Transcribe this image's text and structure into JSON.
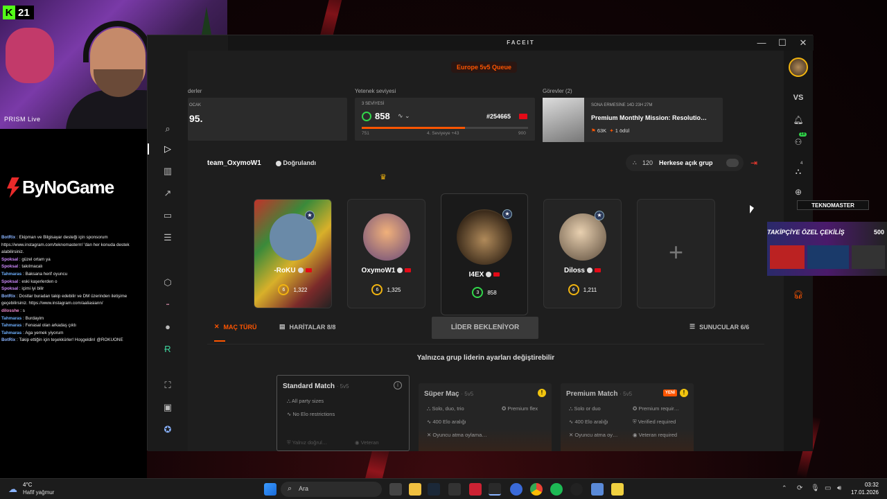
{
  "stream": {
    "kick_badge": "K",
    "viewer_count": "21",
    "prism_label": "PRISM Live",
    "sponsor_logo": "ByNoGame",
    "chat": [
      {
        "user": "BotRix",
        "text": "Ekipman ve Bilgisayar desteği için sponsorum https://www.instagram.com/teknomasterrr/ 'dan her konuda destek alabilirsiniz."
      },
      {
        "user": "Spoksal",
        "text": "güzel ortam ya"
      },
      {
        "user": "Spoksal",
        "text": "takılmacalı"
      },
      {
        "user": "Tahmaras",
        "text": "Baksana herif oyuncu"
      },
      {
        "user": "Spoksal",
        "text": "eski kaşerlerden o"
      },
      {
        "user": "Spoksal",
        "text": "içimi iyi bilir"
      },
      {
        "user": "BotRix",
        "text": "Dostlar buradan takip edebilir ve DM üzerinden iletişime geçebilirsiniz. https://www.instagram.com/aaliasiann/"
      },
      {
        "user": "dilosshe",
        "text": "s"
      },
      {
        "user": "Tahmaras",
        "text": "Burdayim"
      },
      {
        "user": "Tahmaras",
        "text": "Fenasal olan arkadaş çıktı"
      },
      {
        "user": "Tahmaras",
        "text": "Aga yemek yiyorum"
      },
      {
        "user": "BotRix",
        "text": "Takip ettiğin için teşekkürler! Hoşgeldin! @ROKUONE"
      }
    ],
    "overlay_brand": "TEKNOMASTER",
    "overlay_promo": "TAKİPÇİYE ÖZEL ÇEKİLİŞ",
    "overlay_promo_num": "500"
  },
  "window": {
    "title": "FACEIT",
    "minimize": "—",
    "maximize": "☐",
    "close": "✕"
  },
  "queue": "Europe 5v5 Queue",
  "header": {
    "col1_label": "derler",
    "col1_sub": "OCAK",
    "col1_value": "95.",
    "skill_label": "Yetenek seviyesi",
    "skill_level_text": "3 SEVİYESİ",
    "elo": "858",
    "rank": "#254665",
    "range_min": "751",
    "range_mid": "4. Seviyeye +43",
    "range_max": "900",
    "progress": 0.62,
    "missions_label": "Görevler (2)",
    "mission_deadline": "SONA ERMESİNE 14D 23H 27M",
    "mission_title": "Premium Monthly Mission: Resolutio…",
    "mission_points": "63K",
    "mission_reward": "1 ödül"
  },
  "team": {
    "name": "team_OxymoW1",
    "verified": "Doğrulandı",
    "count": "120",
    "party_label": "Herkese açık grup"
  },
  "players": [
    {
      "name": "-RoKU",
      "level": "6",
      "elo": "1,322",
      "color": "#f1b40f"
    },
    {
      "name": "OxymoW1",
      "level": "6",
      "elo": "1,325",
      "color": "#f1b40f"
    },
    {
      "name": "I4EX",
      "level": "3",
      "elo": "858",
      "color": "#32d74b"
    },
    {
      "name": "Diloss",
      "level": "6",
      "elo": "1,211",
      "color": "#f1b40f"
    }
  ],
  "add_slot": "+",
  "tabs": {
    "mode": "MAÇ TÜRÜ",
    "maps": "HARİTALAR 8/8",
    "leader": "LİDER BEKLENİYOR",
    "servers": "SUNUCULAR 6/6"
  },
  "notice": "Yalnızca grup liderin ayarları değiştirebilir",
  "modes": [
    {
      "title": "Standard Match",
      "sub": "· 5v5",
      "r1": "All party sizes",
      "r2": "No Elo restrictions",
      "r3": "Yalnız doğrul…",
      "r4": "Veteran"
    },
    {
      "title": "Süper Maç",
      "sub": "· 5v5",
      "r1": "Solo, duo, trio",
      "r1b": "Premium flex",
      "r2": "400 Elo aralığı",
      "r3": "Oyuncu atma oylama…"
    },
    {
      "title": "Premium Match",
      "sub": "· 5v5",
      "badge": "YENİ",
      "r1": "Solo or duo",
      "r1b": "Premium requir…",
      "r2": "400 Elo aralığı",
      "r2b": "Verified required",
      "r3": "Oyuncu atma oy…",
      "r3b": "Veteran required"
    }
  ],
  "rightbar": {
    "vs": "VS",
    "badge1": "18",
    "badge2": "4"
  },
  "taskbar": {
    "weather_temp": "4°C",
    "weather_desc": "Hafif yağmur",
    "search": "Ara",
    "time": "03:32",
    "date": "17.01.2026"
  }
}
